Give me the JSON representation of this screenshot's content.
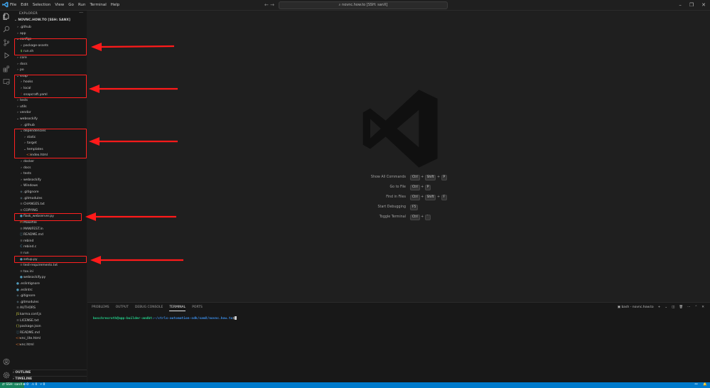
{
  "titlebar": {
    "menu": [
      "File",
      "Edit",
      "Selection",
      "View",
      "Go",
      "Run",
      "Terminal",
      "Help"
    ],
    "search": "novnc.how.to [SSH: sanX]",
    "nav_back": "←",
    "nav_forward": "→",
    "minimize": "–",
    "restore": "❐",
    "close": "✕"
  },
  "sidebar": {
    "title": "EXPLORER",
    "more": "···",
    "root": "NOVNC.HOW.TO [SSH: SANX]",
    "items": [
      {
        "label": ".github",
        "depth": 0,
        "type": "folder",
        "open": false
      },
      {
        "label": "app",
        "depth": 0,
        "type": "folder",
        "open": false
      },
      {
        "label": "configs",
        "depth": 0,
        "type": "folder",
        "open": true
      },
      {
        "label": "package-assets",
        "depth": 1,
        "type": "folder",
        "open": false
      },
      {
        "label": "run.sh",
        "depth": 1,
        "type": "file",
        "icon": "$"
      },
      {
        "label": "core",
        "depth": 0,
        "type": "folder",
        "open": false
      },
      {
        "label": "docs",
        "depth": 0,
        "type": "folder",
        "open": false
      },
      {
        "label": "po",
        "depth": 0,
        "type": "folder",
        "open": false
      },
      {
        "label": "snap",
        "depth": 0,
        "type": "folder",
        "open": true
      },
      {
        "label": "hooks",
        "depth": 1,
        "type": "folder",
        "open": false
      },
      {
        "label": "local",
        "depth": 1,
        "type": "folder",
        "open": false
      },
      {
        "label": "snapcraft.yaml",
        "depth": 1,
        "type": "file",
        "icon": "!"
      },
      {
        "label": "tests",
        "depth": 0,
        "type": "folder",
        "open": false
      },
      {
        "label": "utils",
        "depth": 0,
        "type": "folder",
        "open": false
      },
      {
        "label": "vendor",
        "depth": 0,
        "type": "folder",
        "open": false
      },
      {
        "label": "websockify",
        "depth": 0,
        "type": "folder",
        "open": true
      },
      {
        "label": ".github",
        "depth": 1,
        "type": "folder",
        "open": false
      },
      {
        "label": "dependencies",
        "depth": 1,
        "type": "folder",
        "open": true
      },
      {
        "label": "static",
        "depth": 2,
        "type": "folder",
        "open": false
      },
      {
        "label": "target",
        "depth": 2,
        "type": "folder",
        "open": false
      },
      {
        "label": "templates",
        "depth": 2,
        "type": "folder",
        "open": true
      },
      {
        "label": "index.html",
        "depth": 3,
        "type": "file",
        "icon": "<>"
      },
      {
        "label": "docker",
        "depth": 1,
        "type": "folder",
        "open": false
      },
      {
        "label": "docs",
        "depth": 1,
        "type": "folder",
        "open": false
      },
      {
        "label": "tests",
        "depth": 1,
        "type": "folder",
        "open": false
      },
      {
        "label": "websockify",
        "depth": 1,
        "type": "folder",
        "open": false
      },
      {
        "label": "Windows",
        "depth": 1,
        "type": "folder",
        "open": false
      },
      {
        "label": ".gitignore",
        "depth": 1,
        "type": "file",
        "icon": "◆"
      },
      {
        "label": ".gitmodules",
        "depth": 1,
        "type": "file",
        "icon": "◆"
      },
      {
        "label": "CHANGES.txt",
        "depth": 1,
        "type": "file",
        "icon": "≡"
      },
      {
        "label": "COPYING",
        "depth": 1,
        "type": "file",
        "icon": "≡"
      },
      {
        "label": "flask_webserver.py",
        "depth": 1,
        "type": "file",
        "icon": "●"
      },
      {
        "label": "Makefile",
        "depth": 1,
        "type": "file",
        "icon": "M"
      },
      {
        "label": "MANIFEST.in",
        "depth": 1,
        "type": "file",
        "icon": "≡"
      },
      {
        "label": "README.md",
        "depth": 1,
        "type": "file",
        "icon": "ⓘ"
      },
      {
        "label": "rebind",
        "depth": 1,
        "type": "file",
        "icon": "≡"
      },
      {
        "label": "rebind.c",
        "depth": 1,
        "type": "file",
        "icon": "C"
      },
      {
        "label": "run",
        "depth": 1,
        "type": "file",
        "icon": "≡"
      },
      {
        "label": "setup.py",
        "depth": 1,
        "type": "file",
        "icon": "●"
      },
      {
        "label": "test-requirements.txt",
        "depth": 1,
        "type": "file",
        "icon": "≡"
      },
      {
        "label": "tox.ini",
        "depth": 1,
        "type": "file",
        "icon": "≡"
      },
      {
        "label": "websockify.py",
        "depth": 1,
        "type": "file",
        "icon": "●"
      },
      {
        "label": ".eslintignore",
        "depth": 0,
        "type": "file",
        "icon": "●"
      },
      {
        "label": ".eslintrc",
        "depth": 0,
        "type": "file",
        "icon": "●"
      },
      {
        "label": ".gitignore",
        "depth": 0,
        "type": "file",
        "icon": "◆"
      },
      {
        "label": ".gitmodules",
        "depth": 0,
        "type": "file",
        "icon": "◆"
      },
      {
        "label": "AUTHORS",
        "depth": 0,
        "type": "file",
        "icon": "≡"
      },
      {
        "label": "karma.conf.js",
        "depth": 0,
        "type": "file",
        "icon": "JS"
      },
      {
        "label": "LICENSE.txt",
        "depth": 0,
        "type": "file",
        "icon": "≡"
      },
      {
        "label": "package.json",
        "depth": 0,
        "type": "file",
        "icon": "{}"
      },
      {
        "label": "README.md",
        "depth": 0,
        "type": "file",
        "icon": "ⓘ"
      },
      {
        "label": "vnc_lite.html",
        "depth": 0,
        "type": "file",
        "icon": "<>"
      },
      {
        "label": "vnc.html",
        "depth": 0,
        "type": "file",
        "icon": "<>"
      }
    ],
    "outline": "OUTLINE",
    "timeline": "TIMELINE"
  },
  "editor": {
    "shortcuts": [
      {
        "label": "Show All Commands",
        "keys": [
          "Ctrl",
          "+",
          "Shift",
          "+",
          "P"
        ]
      },
      {
        "label": "Go to File",
        "keys": [
          "Ctrl",
          "+",
          "P"
        ]
      },
      {
        "label": "Find in Files",
        "keys": [
          "Ctrl",
          "+",
          "Shift",
          "+",
          "F"
        ]
      },
      {
        "label": "Start Debugging",
        "keys": [
          "F5"
        ]
      },
      {
        "label": "Toggle Terminal",
        "keys": [
          "Ctrl",
          "+",
          "`"
        ]
      }
    ]
  },
  "panel": {
    "tabs": [
      "PROBLEMS",
      "OUTPUT",
      "DEBUG CONSOLE",
      "TERMINAL",
      "PORTS"
    ],
    "active_tab": "TERMINAL",
    "terminal_name": "bash - novnc.how.to",
    "prompt_user": "boschrexroth@app-builder-andbt",
    "prompt_path": ":~/ctrlx-automation-sdk/samX/novnc.how.to",
    "prompt_symbol": "$"
  },
  "statusbar": {
    "remote": "SSH: sanX",
    "errors": "⊗ 0",
    "warnings": "⚠ 0",
    "ports": "⑂ 0"
  },
  "colors": {
    "accent": "#007acc",
    "annotation": "#ff2020",
    "terminal_user": "#23d18b",
    "terminal_path": "#3b8eea"
  }
}
